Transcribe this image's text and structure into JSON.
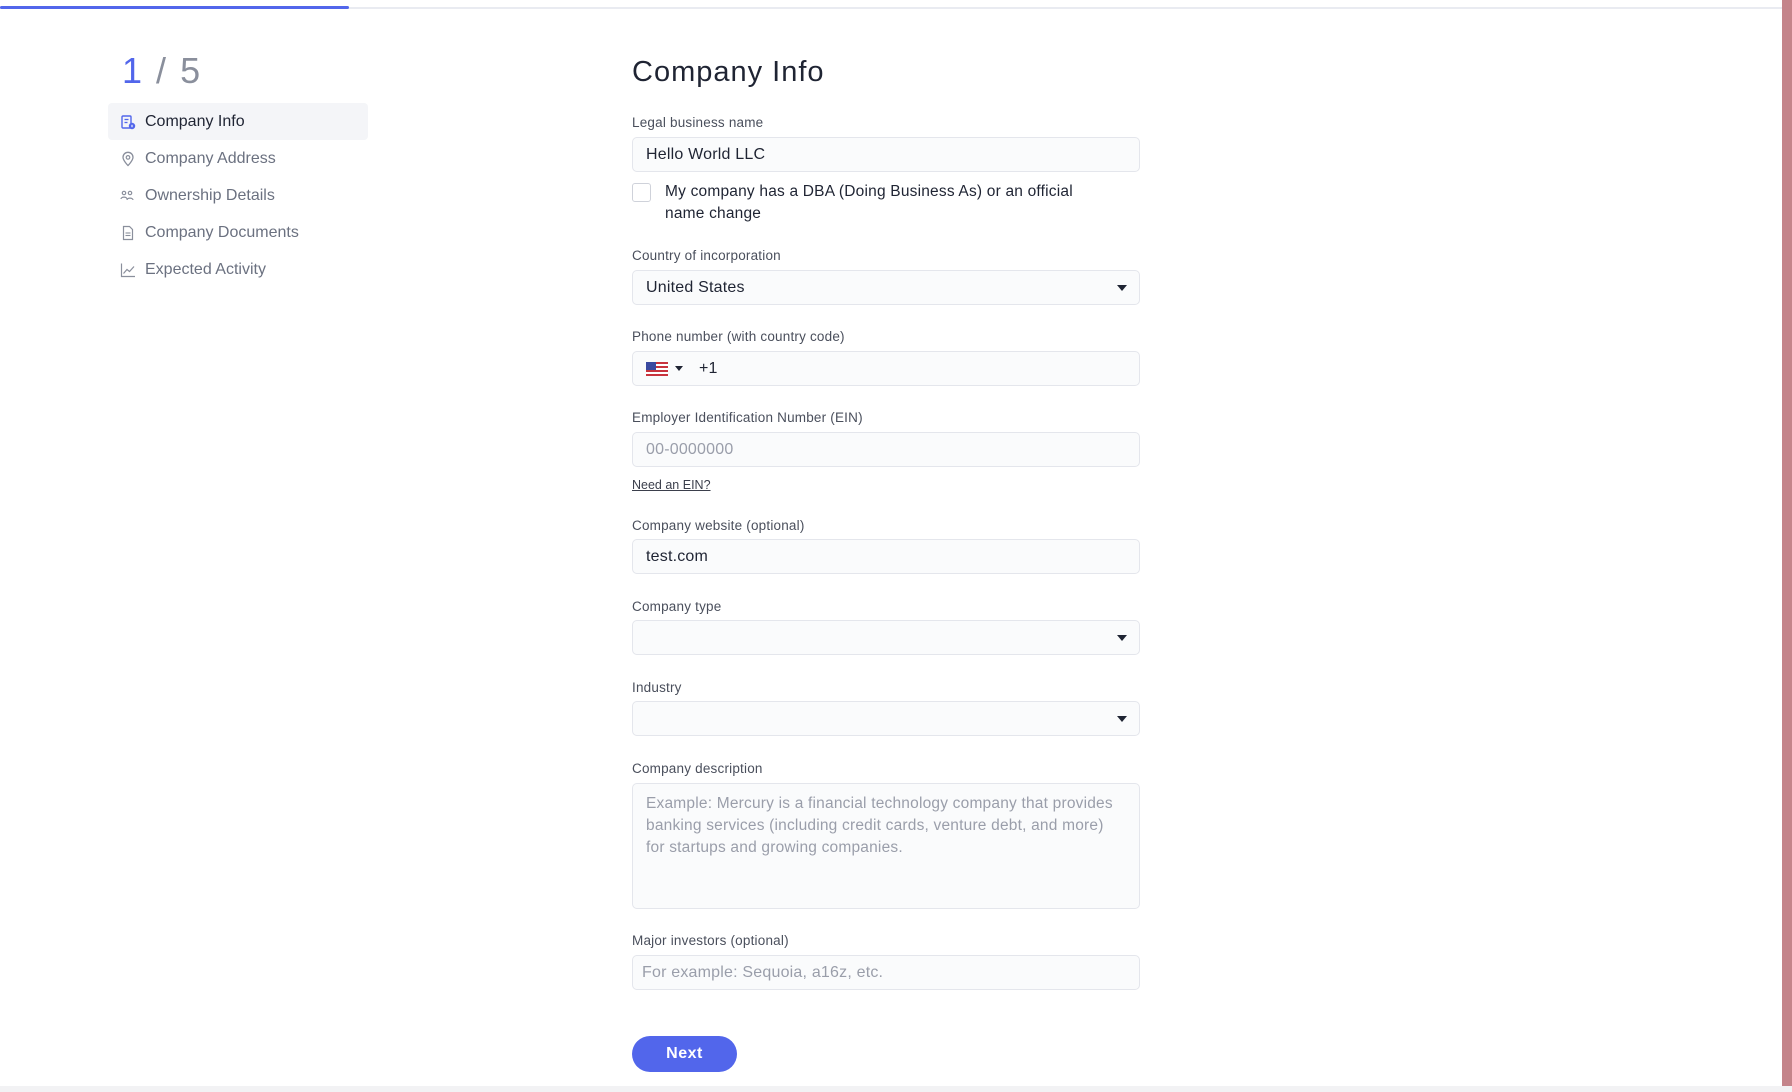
{
  "progress": {
    "fraction": 0.2
  },
  "sidebar": {
    "step_current": "1",
    "step_separator": "/",
    "step_total": "5",
    "items": [
      {
        "label": "Company Info",
        "icon": "company-info-icon",
        "active": true
      },
      {
        "label": "Company Address",
        "icon": "location-pin-icon",
        "active": false
      },
      {
        "label": "Ownership Details",
        "icon": "people-icon",
        "active": false
      },
      {
        "label": "Company Documents",
        "icon": "document-icon",
        "active": false
      },
      {
        "label": "Expected Activity",
        "icon": "line-chart-icon",
        "active": false
      }
    ]
  },
  "form": {
    "title": "Company Info",
    "legal_name": {
      "label": "Legal business name",
      "value": "Hello World LLC"
    },
    "dba_checkbox": {
      "label": "My company has a DBA (Doing Business As) or an official name change",
      "checked": false
    },
    "country": {
      "label": "Country of incorporation",
      "value": "United States"
    },
    "phone": {
      "label": "Phone number (with country code)",
      "code": "+1",
      "flag": "us-flag-icon"
    },
    "ein": {
      "label": "Employer Identification Number (EIN)",
      "placeholder": "00-0000000",
      "help_link": "Need an EIN?"
    },
    "website": {
      "label": "Company website (optional)",
      "value": "test.com"
    },
    "company_type": {
      "label": "Company type",
      "value": ""
    },
    "industry": {
      "label": "Industry",
      "value": ""
    },
    "description": {
      "label": "Company description",
      "placeholder": "Example: Mercury is a financial technology company that provides banking services (including credit cards, venture debt, and more) for startups and growing companies."
    },
    "investors": {
      "label": "Major investors (optional)",
      "placeholder": "For example: Sequoia, a16z, etc."
    },
    "next_label": "Next"
  },
  "colors": {
    "accent": "#5266eb",
    "right_edge": "#c4848a"
  }
}
